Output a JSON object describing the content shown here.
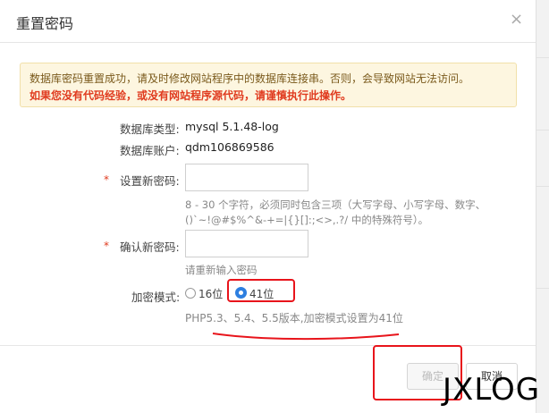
{
  "dialog": {
    "title": "重置密码",
    "close_icon": "close-icon"
  },
  "notice": {
    "line1": "数据库密码重置成功，请及时修改网站程序中的数据库连接串。否则，会导致网站无法访问。",
    "line2": "如果您没有代码经验，或没有网站程序源代码，请谨慎执行此操作。"
  },
  "form": {
    "db_type_label": "数据库类型:",
    "db_type_value": "mysql 5.1.48-log",
    "db_account_label": "数据库账户:",
    "db_account_value": "qdm106869586",
    "required_mark": "*",
    "new_password_label": "设置新密码:",
    "new_password_value": "",
    "new_password_hint_line1": "8 - 30 个字符，必须同时包含三项（大写字母、小写字母、数字、",
    "new_password_hint_line2": "()`~!@#$%^&-+=|{}[]:;<>,.?/ 中的特殊符号）。",
    "confirm_password_label": "确认新密码:",
    "confirm_password_value": "",
    "confirm_password_hint": "请重新输入密码",
    "encrypt_mode_label": "加密模式:",
    "encrypt_options": [
      {
        "label": "16位",
        "checked": false
      },
      {
        "label": "41位",
        "checked": true
      }
    ],
    "encrypt_hint": "PHP5.3、5.4、5.5版本,加密模式设置为41位"
  },
  "footer": {
    "confirm_label": "确定",
    "cancel_label": "取消"
  },
  "watermark": "JXLOG",
  "colors": {
    "annotation_red": "#e8141b",
    "radio_blue": "#2d7fe0",
    "notice_bg": "#fdf6e0",
    "warning_red": "#e03b1f"
  }
}
